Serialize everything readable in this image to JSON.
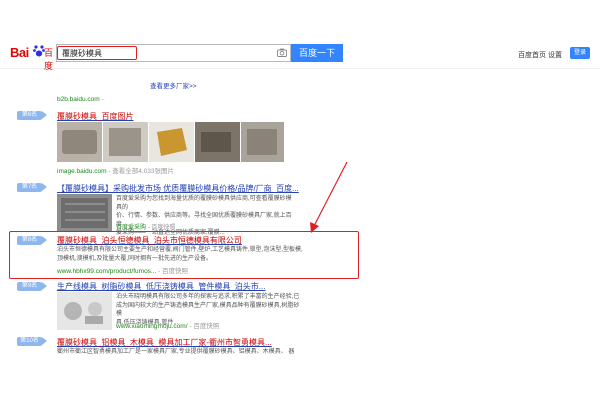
{
  "header": {
    "logo_bai": "Bai",
    "logo_du": "百度",
    "query": "覆膜砂模具",
    "search_button": "百度一下",
    "links": [
      "百度首页",
      "设置"
    ],
    "login": "登录"
  },
  "top_area": {
    "more_link": "查看更多厂家>>",
    "url": "b2b.baidu.com",
    "url_suffix": "-"
  },
  "results": [
    {
      "rank": "第6名",
      "title": "覆膜砂模具_百度图片",
      "url": "image.baidu.com",
      "url_suffix": "- 查看全部4,033张图片"
    },
    {
      "rank": "第7名",
      "title": "【覆膜砂模具】采购批发市场 优质覆膜砂模具价格/品牌/厂商_百度...",
      "desc_lines": [
        "百度爱采购为您找到海量优质的覆膜砂模具供应商,可查看覆膜砂模具的",
        "价、行情、参数、供应商等。寻找全国优质覆膜砂模具厂家,就上百度",
        "爱采购——一站直达全网优质商家,覆膜..."
      ],
      "badge": "百度爱采购",
      "url": "",
      "url_suffix": "- 百度快照"
    },
    {
      "rank": "第8名",
      "title": "覆膜砂模具_泊头恒德模具_泊头市恒德模具有限公司",
      "desc_lines": [
        "泊头市恒德模具有限公司主要生产和经营覆,阀门管件,壁炉,工艺模具铸件,锁型,泡沫型,型板模,",
        "顶模机,澳模机,及批量大覆,同时拥有一批先进的生产设备。"
      ],
      "url": "www.hbhx99.com/product/fumos...",
      "url_suffix": "- 百度快照"
    },
    {
      "rank": "第9名",
      "title": "生产线模具_树脂砂模具_低压浇铸模具_管件模具_泊头市...",
      "desc_lines": [
        "泊头市晓明模具有限公司多年的探索与追求,积累了丰富的生产经验,已",
        "成为国内较大的生产铸造模具生产厂家,模具品种有覆膜砂模具,树脂砂模",
        "具,低压浇铸模具,管件..."
      ],
      "url": "www.xiaomingmoju.com/",
      "url_suffix": "- 百度快照"
    },
    {
      "rank": "第10名",
      "title": "覆膜砂模具_铝模具_木模具_模具加工厂家-衢州市智勇模具...",
      "desc_lines": [
        "衢州市衢江区智勇模具加工厂是一家模具厂家,专业提供覆膜砂模具、铝模具、木模具、 器"
      ]
    }
  ],
  "colors": {
    "brand_blue": "#3385ff",
    "title_blue": "#2440b3",
    "highlight_red": "#c00000",
    "annotation_red": "#e02020",
    "url_green": "#1a8a1a",
    "rank_marker": "#8eb7ee"
  }
}
